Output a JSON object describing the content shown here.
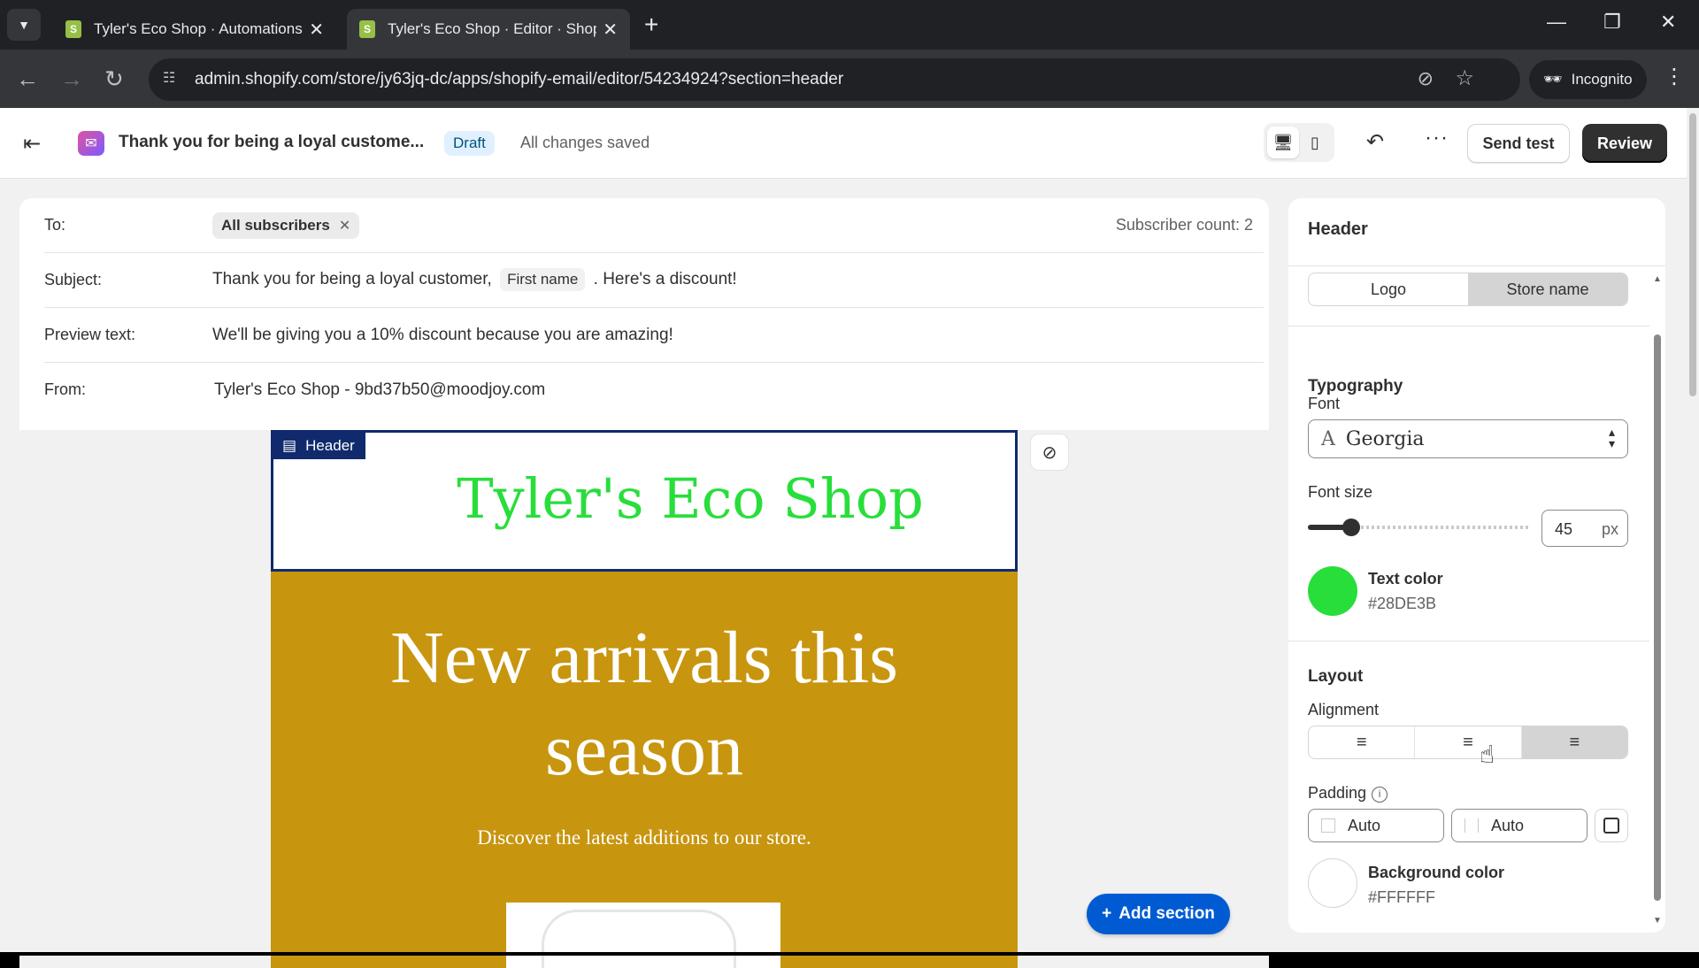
{
  "browser": {
    "tabs": [
      {
        "title": "Tyler's Eco Shop · Automations",
        "favicon": "S"
      },
      {
        "title": "Tyler's Eco Shop · Editor · Shopify",
        "favicon": "S"
      }
    ],
    "url": "admin.shopify.com/store/jy63jq-dc/apps/shopify-email/editor/54234924?section=header",
    "incognito_label": "Incognito"
  },
  "appbar": {
    "title": "Thank you for being a loyal custome...",
    "status": "Draft",
    "save_state": "All changes saved",
    "send_test": "Send test",
    "review": "Review"
  },
  "email_meta": {
    "to_label": "To:",
    "to_chip": "All subscribers",
    "subscriber_count": "Subscriber count: 2",
    "subject_label": "Subject:",
    "subject_before": "Thank you for being a loyal customer,",
    "subject_var": "First name",
    "subject_after": ". Here's a discount!",
    "preview_label": "Preview text:",
    "preview_value": "We'll be giving you a 10% discount because you are amazing!",
    "from_label": "From:",
    "from_value": "Tyler's Eco Shop - 9bd37b50@moodjoy.com"
  },
  "canvas": {
    "header_tag": "Header",
    "store_name": "Tyler's Eco Shop",
    "hero_title": "New arrivals this season",
    "hero_subtitle": "Discover the latest additions to our store.",
    "add_section": "Add section",
    "hero_bg": "#C8950F"
  },
  "panel": {
    "title": "Header",
    "header_type": {
      "options": [
        "Logo",
        "Store name"
      ],
      "selected": "Store name"
    },
    "typography_heading": "Typography",
    "font_label": "Font",
    "font_value": "Georgia",
    "font_size_label": "Font size",
    "font_size_value": "45",
    "font_size_unit": "px",
    "font_size_slider_fraction": 0.17,
    "text_color_label": "Text color",
    "text_color_value": "#28DE3B",
    "layout_heading": "Layout",
    "alignment_label": "Alignment",
    "alignment_options": [
      "left",
      "center",
      "right"
    ],
    "alignment_selected": "right",
    "padding_label": "Padding",
    "padding_horizontal": "Auto",
    "padding_vertical": "Auto",
    "bg_color_label": "Background color",
    "bg_color_value": "#FFFFFF"
  }
}
